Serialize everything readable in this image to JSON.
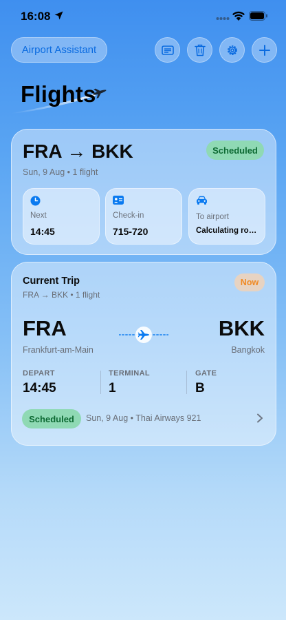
{
  "status_bar": {
    "time": "16:08"
  },
  "header": {
    "assistant_label": "Airport Assistant",
    "title": "Flights",
    "actions": [
      "boarding-pass-icon",
      "trash-icon",
      "gear-icon",
      "plus-icon"
    ]
  },
  "summary": {
    "route": "FRA → BKK",
    "subtitle": "Sun, 9 Aug • 1 flight",
    "status": "Scheduled",
    "tiles": [
      {
        "icon": "clock-icon",
        "label": "Next",
        "value": "14:45"
      },
      {
        "icon": "id-card-icon",
        "label": "Check-in",
        "value": "715-720"
      },
      {
        "icon": "car-icon",
        "label": "To airport",
        "value": "Calculating rou…"
      }
    ]
  },
  "current_trip": {
    "title": "Current Trip",
    "subtitle": "FRA → BKK • 1 flight",
    "badge": "Now",
    "origin": {
      "code": "FRA",
      "city": "Frankfurt-am-Main"
    },
    "destination": {
      "code": "BKK",
      "city": "Bangkok"
    },
    "depart_label": "DEPART",
    "depart_value": "14:45",
    "terminal_label": "TERMINAL",
    "terminal_value": "1",
    "gate_label": "GATE",
    "gate_value": "B",
    "status": "Scheduled",
    "details": "Sun, 9 Aug • Thai Airways 921"
  },
  "colors": {
    "accent": "#0a6be0",
    "scheduled_bg": "#8fd9b4",
    "scheduled_text": "#0d6a33",
    "now_text": "#f08a25"
  }
}
